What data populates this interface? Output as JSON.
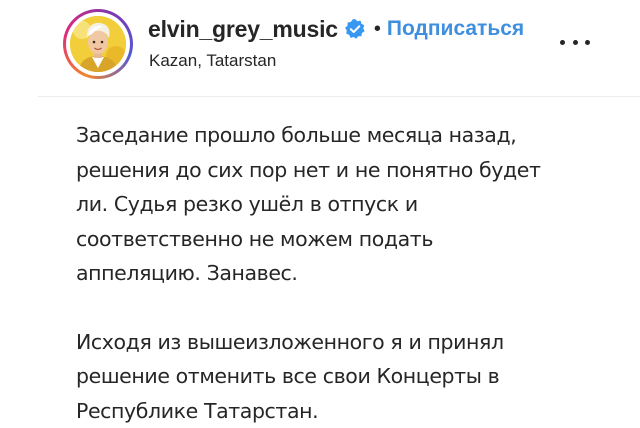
{
  "header": {
    "username": "elvin_grey_music",
    "follow_label": "Подписаться",
    "separator": "•",
    "location": "Kazan, Tatarstan",
    "verified_icon": "verified-badge-icon",
    "more_icon": "more-options-icon"
  },
  "colors": {
    "link_blue": "#3f8fdf",
    "verified_blue": "#3897f0",
    "text": "#262626",
    "divider": "#ececec"
  },
  "post": {
    "paragraphs": [
      {
        "lines": [
          "Заседание прошло больше месяца назад,",
          "решения до сих пор нет и не понятно будет",
          "ли. Судья резко ушёл в отпуск и",
          "соответственно не можем подать",
          "аппеляцию. Занавес."
        ]
      },
      {
        "lines": [
          "Исходя из вышеизложенного я и принял",
          "решение отменить все свои Концерты в",
          "Республике Татарстан."
        ]
      }
    ]
  }
}
